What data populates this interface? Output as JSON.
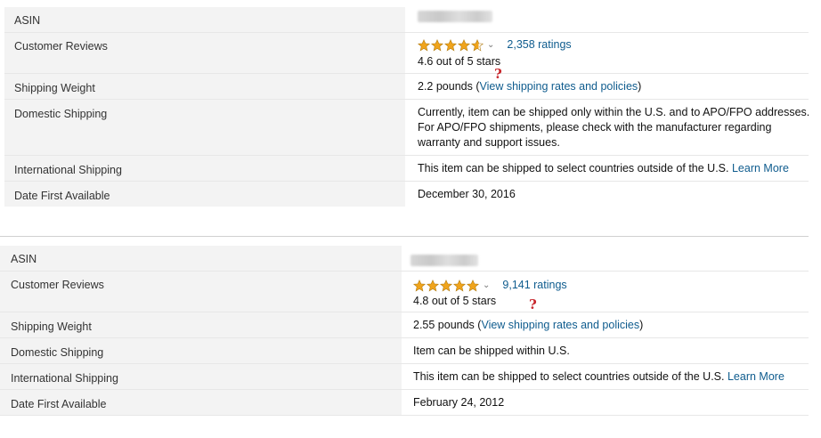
{
  "tables": [
    {
      "asin_label": "ASIN",
      "reviews_label": "Customer Reviews",
      "rating_text": "4.6 out of 5 stars",
      "ratings_count": "2,358 ratings",
      "stars_value": 4.6,
      "shipping_weight_label": "Shipping Weight",
      "shipping_weight_value": "2.2 pounds (",
      "shipping_rates_link": "View shipping rates and policies",
      "shipping_weight_close": ")",
      "domestic_label": "Domestic Shipping",
      "domestic_lines": [
        "Currently, item can be shipped only within the U.S. and to APO/FPO addresses.",
        "For APO/FPO shipments, please check with the manufacturer regarding",
        "warranty and support issues."
      ],
      "international_label": "International Shipping",
      "international_value": "This item can be shipped to select countries outside of the U.S.",
      "learn_more": "Learn More",
      "date_label": "Date First Available",
      "date_value": "December 30, 2016"
    },
    {
      "asin_label": "ASIN",
      "reviews_label": "Customer Reviews",
      "rating_text": "4.8 out of 5 stars",
      "ratings_count": "9,141 ratings",
      "stars_value": 4.8,
      "shipping_weight_label": "Shipping Weight",
      "shipping_weight_value": "2.55 pounds (",
      "shipping_rates_link": "View shipping rates and policies",
      "shipping_weight_close": ")",
      "domestic_label": "Domestic Shipping",
      "domestic_value": "Item can be shipped within U.S.",
      "international_label": "International Shipping",
      "international_value": "This item can be shipped to select countries outside of the U.S.",
      "learn_more": "Learn More",
      "date_label": "Date First Available",
      "date_value": "February 24, 2012"
    }
  ],
  "annotation_mark": "?",
  "colors": {
    "star": "#f0a41c",
    "link": "#0f5c8e",
    "label_bg": "#f3f3f3",
    "question": "#c7252b"
  },
  "icons": [
    "star-icon",
    "half-star-icon",
    "chevron-down-icon",
    "question-mark-icon"
  ]
}
